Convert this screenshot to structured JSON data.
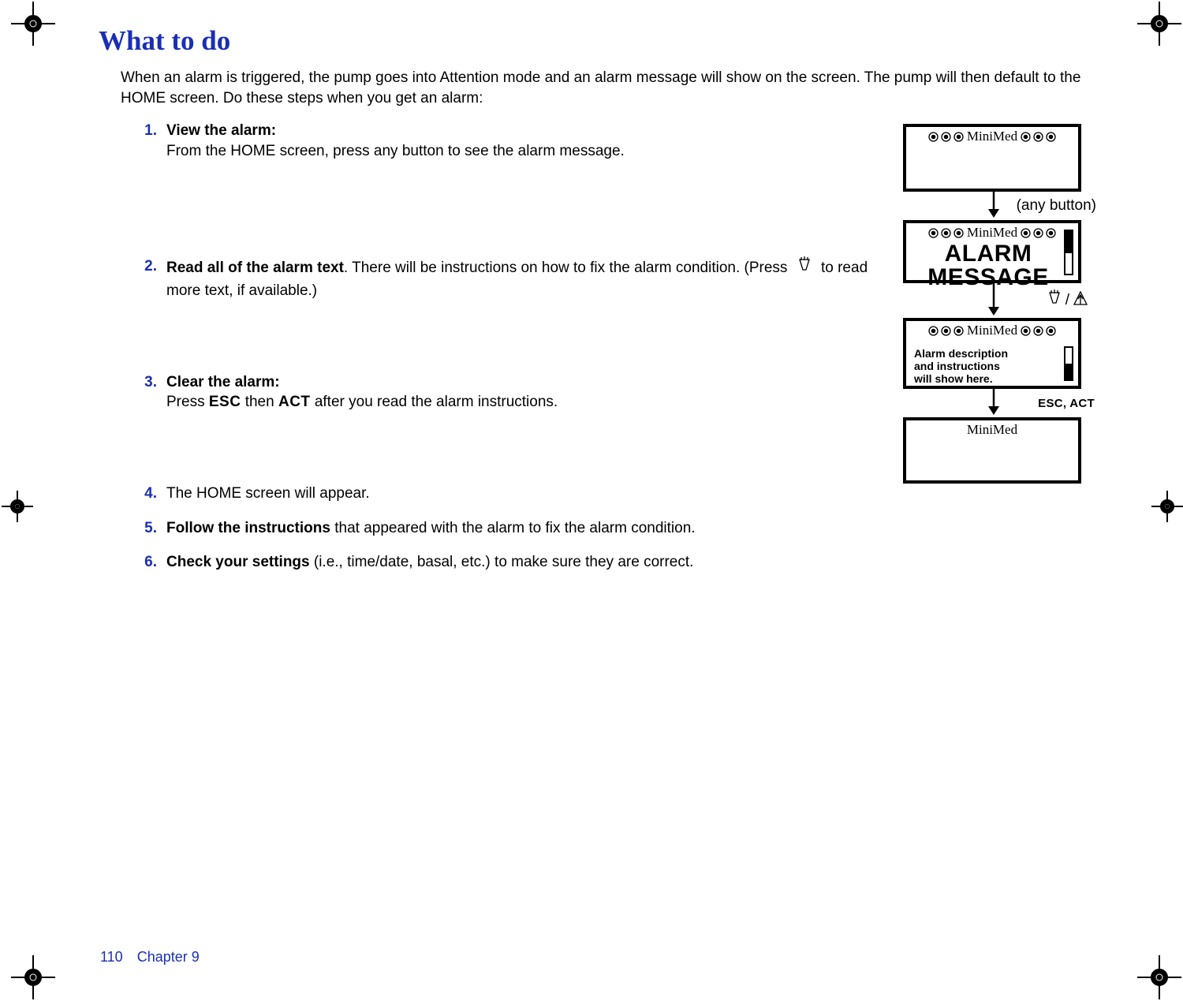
{
  "title": "What to do",
  "intro": "When an alarm is triggered, the pump goes into Attention mode and an alarm message will show on the screen. The pump will then default to the HOME screen. Do these steps when you get an alarm:",
  "steps": [
    {
      "num": "1.",
      "bold": "View the alarm:",
      "rest_newline": true,
      "rest": "From the HOME screen, press any button to see the alarm message."
    },
    {
      "num": "2.",
      "bold": "Read all of the alarm text",
      "rest_newline": false,
      "rest": ". There will be instructions on how to fix the alarm condition. (Press ",
      "after_icon": " to read more text, if available.)",
      "has_icon": true
    },
    {
      "num": "3.",
      "bold": "Clear the alarm:",
      "rest_newline": true,
      "rest_pre": "Press ",
      "key1": "ESC",
      "mid": " then ",
      "key2": "ACT",
      "rest_post": " after you read the alarm instructions."
    },
    {
      "num": "4.",
      "bold": "",
      "rest_newline": false,
      "rest": "The HOME screen will appear."
    },
    {
      "num": "5.",
      "bold": "Follow the instructions",
      "rest_newline": false,
      "rest": " that appeared with the alarm to fix the alarm condition."
    },
    {
      "num": "6.",
      "bold": "Check your settings",
      "rest_newline": false,
      "rest": " (i.e., time/date, basal, etc.) to make sure they are correct."
    }
  ],
  "screens": {
    "brand": "MiniMed",
    "any_button_label": "(any button)",
    "alarm_line1": "ALARM",
    "alarm_line2": "MESSAGE",
    "slash": "/",
    "desc_line1": "Alarm description",
    "desc_line2": "and instructions",
    "desc_line3": "will show here.",
    "esc_act": "ESC, ACT"
  },
  "footer": {
    "page": "110",
    "chapter": "Chapter 9"
  }
}
